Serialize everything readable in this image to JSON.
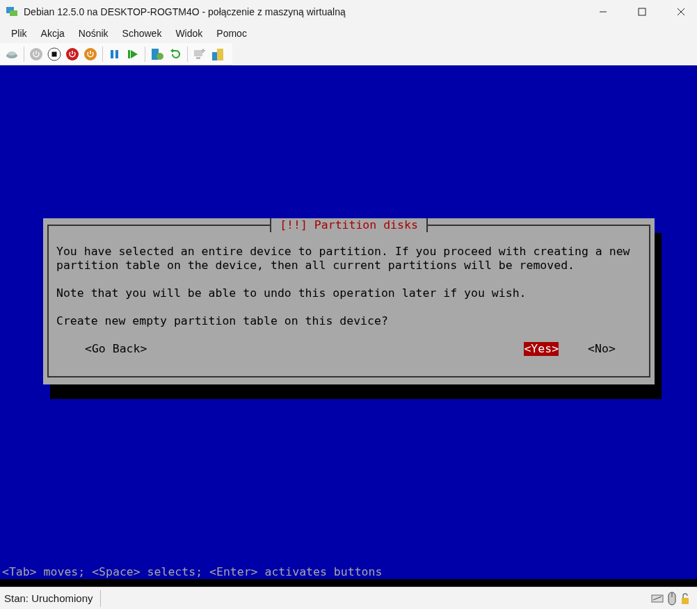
{
  "window": {
    "title": "Debian 12.5.0 na DESKTOP-ROGTM4O - połączenie z maszyną wirtualną"
  },
  "menu": [
    "Plik",
    "Akcja",
    "Nośnik",
    "Schowek",
    "Widok",
    "Pomoc"
  ],
  "dialog": {
    "title": "[!!] Partition disks",
    "paragraphs": [
      "You have selected an entire device to partition. If you proceed with creating a new partition table on the device, then all current partitions will be removed.",
      "Note that you will be able to undo this operation later if you wish.",
      "Create new empty partition table on this device?"
    ],
    "buttons": [
      {
        "label": "<Go Back>",
        "selected": false
      },
      {
        "label": "<Yes>",
        "selected": true
      },
      {
        "label": "<No>",
        "selected": false
      }
    ]
  },
  "help_line": "<Tab> moves; <Space> selects; <Enter> activates buttons",
  "status_bar": {
    "text": "Stan: Uruchomiony"
  }
}
